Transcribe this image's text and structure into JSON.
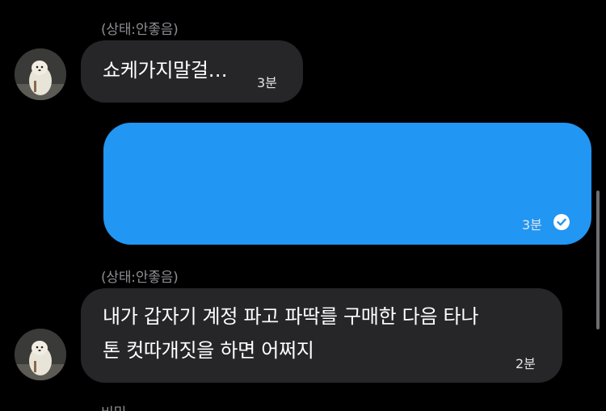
{
  "colors": {
    "background": "#000000",
    "incoming_bubble": "#262629",
    "outgoing_bubble": "#2196f3",
    "secondary_text": "#8e8e93"
  },
  "messages": [
    {
      "type": "incoming",
      "sender": "(상태:안좋음)",
      "avatar": "white-fluffy-dog-avatar",
      "text": "쇼케가지말걸…",
      "time": "3분"
    },
    {
      "type": "outgoing",
      "text": "",
      "time": "3분",
      "status_icon": "read-check-icon"
    },
    {
      "type": "incoming",
      "sender": "(상태:안좋음)",
      "avatar": "white-fluffy-dog-avatar",
      "text_lines": [
        "내가 갑자기 계정 파고 파딱를 구매한 다음 타나",
        "톤 컷따개짓을 하면 어쩌지"
      ],
      "time": "2분"
    }
  ],
  "next_sender_partial": "비밀"
}
